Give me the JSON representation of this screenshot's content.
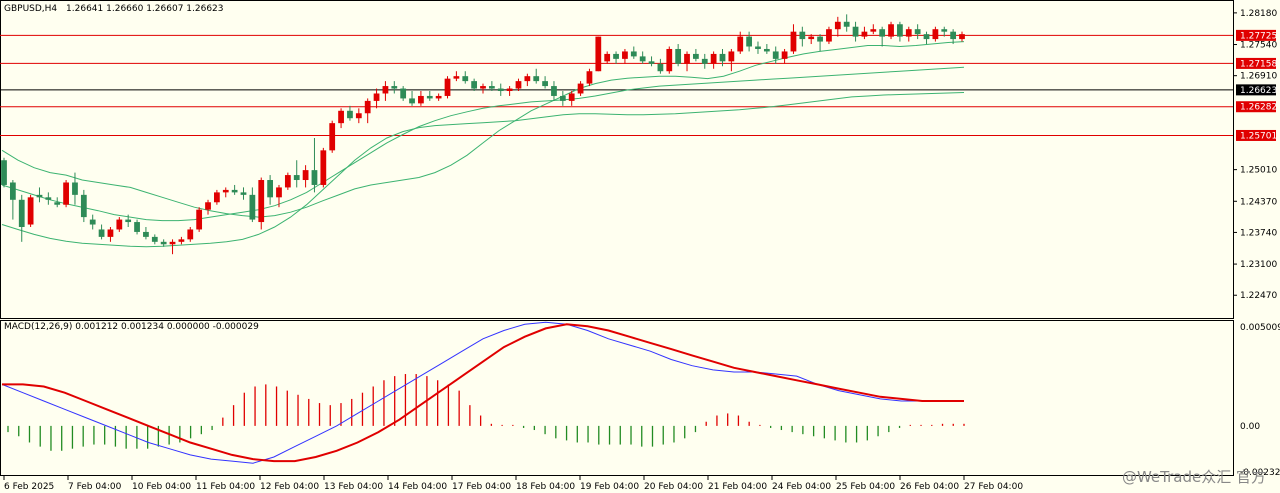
{
  "header": {
    "symbol": "GBPUSD,H4",
    "ohlc": "1.26641 1.26660 1.26607 1.26623"
  },
  "macd_label": "MACD(12,26,9) 0.001212 0.001234 0.000000 -0.000029",
  "watermark": "@WeTrade众汇 官方",
  "chart_data": [
    {
      "type": "candlestick",
      "title": "GBPUSD,H4",
      "ylim": [
        1.2205,
        1.284
      ],
      "y_ticks": [
        "1.28180",
        "1.27540",
        "1.26910",
        "1.25010",
        "1.24370",
        "1.23740",
        "1.23100",
        "1.22470"
      ],
      "x_ticks": [
        "6 Feb 2025",
        "7 Feb 04:00",
        "10 Feb 04:00",
        "11 Feb 04:00",
        "12 Feb 04:00",
        "13 Feb 04:00",
        "14 Feb 04:00",
        "17 Feb 04:00",
        "18 Feb 04:00",
        "19 Feb 04:00",
        "20 Feb 04:00",
        "21 Feb 04:00",
        "24 Feb 04:00",
        "25 Feb 04:00",
        "26 Feb 04:00",
        "27 Feb 04:00"
      ],
      "horizontal_levels": [
        {
          "value": 1.27725,
          "label": "1.27725"
        },
        {
          "value": 1.27158,
          "label": "1.27158"
        },
        {
          "value": 1.26282,
          "label": "1.26282"
        },
        {
          "value": 1.25701,
          "label": "1.25701"
        }
      ],
      "current_price": {
        "value": 1.26623,
        "label": "1.26623"
      },
      "candles": [
        [
          1.252,
          1.2525,
          1.2465,
          1.247
        ],
        [
          1.2475,
          1.248,
          1.24,
          1.244
        ],
        [
          1.244,
          1.245,
          1.2355,
          1.2385
        ],
        [
          1.239,
          1.245,
          1.2385,
          1.2445
        ],
        [
          1.245,
          1.2465,
          1.2435,
          1.2445
        ],
        [
          1.2445,
          1.2455,
          1.243,
          1.244
        ],
        [
          1.2435,
          1.2445,
          1.2425,
          1.243
        ],
        [
          1.243,
          1.248,
          1.2425,
          1.2475
        ],
        [
          1.2475,
          1.2495,
          1.243,
          1.245
        ],
        [
          1.245,
          1.246,
          1.2395,
          1.2405
        ],
        [
          1.24,
          1.241,
          1.238,
          1.239
        ],
        [
          1.238,
          1.239,
          1.236,
          1.2365
        ],
        [
          1.2365,
          1.2385,
          1.2355,
          1.238
        ],
        [
          1.238,
          1.2405,
          1.2375,
          1.24
        ],
        [
          1.24,
          1.241,
          1.2385,
          1.2395
        ],
        [
          1.2395,
          1.24,
          1.237,
          1.2375
        ],
        [
          1.2375,
          1.2385,
          1.236,
          1.2365
        ],
        [
          1.2365,
          1.237,
          1.235,
          1.2355
        ],
        [
          1.2355,
          1.236,
          1.2345,
          1.235
        ],
        [
          1.235,
          1.236,
          1.233,
          1.2355
        ],
        [
          1.2355,
          1.2365,
          1.235,
          1.236
        ],
        [
          1.236,
          1.2385,
          1.2355,
          1.238
        ],
        [
          1.238,
          1.2425,
          1.2375,
          1.242
        ],
        [
          1.242,
          1.244,
          1.241,
          1.2435
        ],
        [
          1.2435,
          1.246,
          1.243,
          1.2455
        ],
        [
          1.2455,
          1.2465,
          1.2445,
          1.246
        ],
        [
          1.246,
          1.247,
          1.245,
          1.2455
        ],
        [
          1.2455,
          1.2465,
          1.244,
          1.245
        ],
        [
          1.245,
          1.2465,
          1.2395,
          1.24
        ],
        [
          1.2395,
          1.2485,
          1.238,
          1.248
        ],
        [
          1.248,
          1.249,
          1.243,
          1.2445
        ],
        [
          1.2445,
          1.247,
          1.2425,
          1.2465
        ],
        [
          1.2465,
          1.2495,
          1.246,
          1.249
        ],
        [
          1.249,
          1.252,
          1.2465,
          1.248
        ],
        [
          1.248,
          1.251,
          1.2465,
          1.25
        ],
        [
          1.25,
          1.2565,
          1.2455,
          1.247
        ],
        [
          1.247,
          1.2545,
          1.2465,
          1.254
        ],
        [
          1.254,
          1.26,
          1.2535,
          1.2595
        ],
        [
          1.2595,
          1.2625,
          1.2585,
          1.262
        ],
        [
          1.262,
          1.263,
          1.26,
          1.2605
        ],
        [
          1.2605,
          1.2625,
          1.2595,
          1.2615
        ],
        [
          1.2615,
          1.2645,
          1.2595,
          1.264
        ],
        [
          1.264,
          1.2665,
          1.2625,
          1.2655
        ],
        [
          1.2655,
          1.268,
          1.264,
          1.267
        ],
        [
          1.267,
          1.268,
          1.2655,
          1.2665
        ],
        [
          1.2665,
          1.267,
          1.264,
          1.2645
        ],
        [
          1.2645,
          1.266,
          1.263,
          1.2635
        ],
        [
          1.2635,
          1.266,
          1.263,
          1.265
        ],
        [
          1.265,
          1.266,
          1.264,
          1.2645
        ],
        [
          1.2645,
          1.2655,
          1.264,
          1.265
        ],
        [
          1.265,
          1.269,
          1.2645,
          1.2685
        ],
        [
          1.2685,
          1.27,
          1.268,
          1.269
        ],
        [
          1.269,
          1.27,
          1.2675,
          1.268
        ],
        [
          1.268,
          1.2685,
          1.266,
          1.2665
        ],
        [
          1.2665,
          1.2675,
          1.2655,
          1.267
        ],
        [
          1.267,
          1.268,
          1.266,
          1.2665
        ],
        [
          1.2665,
          1.2675,
          1.265,
          1.266
        ],
        [
          1.266,
          1.267,
          1.265,
          1.2665
        ],
        [
          1.2665,
          1.2685,
          1.266,
          1.268
        ],
        [
          1.268,
          1.2695,
          1.267,
          1.269
        ],
        [
          1.269,
          1.2705,
          1.2675,
          1.268
        ],
        [
          1.268,
          1.269,
          1.2665,
          1.267
        ],
        [
          1.267,
          1.268,
          1.264,
          1.265
        ],
        [
          1.265,
          1.266,
          1.263,
          1.264
        ],
        [
          1.264,
          1.266,
          1.263,
          1.2655
        ],
        [
          1.2655,
          1.268,
          1.265,
          1.2675
        ],
        [
          1.2675,
          1.2705,
          1.267,
          1.27
        ],
        [
          1.27,
          1.272,
          1.271,
          1.277
        ],
        [
          1.272,
          1.274,
          1.2715,
          1.2735
        ],
        [
          1.2735,
          1.274,
          1.2715,
          1.2725
        ],
        [
          1.2725,
          1.2745,
          1.2715,
          1.274
        ],
        [
          1.274,
          1.275,
          1.2725,
          1.273
        ],
        [
          1.273,
          1.274,
          1.2715,
          1.272
        ],
        [
          1.272,
          1.273,
          1.271,
          1.2715
        ],
        [
          1.2715,
          1.2725,
          1.2695,
          1.27
        ],
        [
          1.27,
          1.275,
          1.2695,
          1.2745
        ],
        [
          1.2745,
          1.2755,
          1.271,
          1.2715
        ],
        [
          1.2715,
          1.274,
          1.27,
          1.2735
        ],
        [
          1.2735,
          1.2745,
          1.272,
          1.2725
        ],
        [
          1.2725,
          1.2735,
          1.2705,
          1.2715
        ],
        [
          1.2715,
          1.274,
          1.2705,
          1.2735
        ],
        [
          1.2735,
          1.2745,
          1.271,
          1.272
        ],
        [
          1.272,
          1.2745,
          1.27,
          1.274
        ],
        [
          1.274,
          1.278,
          1.2735,
          1.277
        ],
        [
          1.277,
          1.278,
          1.274,
          1.275
        ],
        [
          1.275,
          1.276,
          1.2735,
          1.2745
        ],
        [
          1.2745,
          1.2755,
          1.2735,
          1.274
        ],
        [
          1.274,
          1.275,
          1.2715,
          1.2725
        ],
        [
          1.2725,
          1.2745,
          1.2715,
          1.274
        ],
        [
          1.274,
          1.2795,
          1.2735,
          1.278
        ],
        [
          1.278,
          1.279,
          1.275,
          1.2765
        ],
        [
          1.2765,
          1.2775,
          1.2755,
          1.277
        ],
        [
          1.277,
          1.2775,
          1.274,
          1.276
        ],
        [
          1.276,
          1.279,
          1.2755,
          1.2785
        ],
        [
          1.2785,
          1.281,
          1.277,
          1.28
        ],
        [
          1.28,
          1.2815,
          1.278,
          1.279
        ],
        [
          1.279,
          1.28,
          1.276,
          1.277
        ],
        [
          1.277,
          1.279,
          1.2765,
          1.278
        ],
        [
          1.278,
          1.2795,
          1.2775,
          1.2785
        ],
        [
          1.2785,
          1.279,
          1.275,
          1.277
        ],
        [
          1.277,
          1.28,
          1.2765,
          1.2795
        ],
        [
          1.2795,
          1.28,
          1.276,
          1.277
        ],
        [
          1.277,
          1.279,
          1.276,
          1.2785
        ],
        [
          1.2785,
          1.2795,
          1.2765,
          1.2775
        ],
        [
          1.2775,
          1.278,
          1.2755,
          1.2765
        ],
        [
          1.2765,
          1.279,
          1.276,
          1.2785
        ],
        [
          1.2785,
          1.279,
          1.277,
          1.278
        ],
        [
          1.278,
          1.2785,
          1.2755,
          1.2765
        ],
        [
          1.2765,
          1.278,
          1.276,
          1.2775
        ]
      ],
      "bollinger_upper": [
        1.254,
        1.252,
        1.2505,
        1.2495,
        1.249,
        1.248,
        1.2475,
        1.247,
        1.2465,
        1.2455,
        1.2445,
        1.2435,
        1.2425,
        1.2418,
        1.2412,
        1.2408,
        1.2405,
        1.2408,
        1.2415,
        1.2425,
        1.2438,
        1.245,
        1.2462,
        1.247,
        1.2475,
        1.248,
        1.2485,
        1.2495,
        1.251,
        1.253,
        1.2555,
        1.258,
        1.26,
        1.262,
        1.2635,
        1.265,
        1.2665,
        1.2675,
        1.2682,
        1.2686,
        1.2688,
        1.269,
        1.269,
        1.2688,
        1.2685,
        1.269,
        1.27,
        1.2712,
        1.272,
        1.2728,
        1.2735,
        1.274,
        1.2744,
        1.2748,
        1.2752,
        1.2752,
        1.275,
        1.2752,
        1.2755,
        1.2758,
        1.276
      ],
      "bollinger_middle": [
        1.247,
        1.246,
        1.245,
        1.244,
        1.2432,
        1.2425,
        1.2418,
        1.241,
        1.2405,
        1.24,
        1.2398,
        1.2398,
        1.24,
        1.2405,
        1.241,
        1.2415,
        1.242,
        1.2428,
        1.244,
        1.2455,
        1.2475,
        1.2495,
        1.2515,
        1.2535,
        1.2555,
        1.2572,
        1.2588,
        1.26,
        1.261,
        1.2618,
        1.2625,
        1.263,
        1.2634,
        1.2638,
        1.264,
        1.2642,
        1.2645,
        1.265,
        1.2656,
        1.2662,
        1.2666,
        1.267,
        1.2672,
        1.2674,
        1.2676,
        1.2678,
        1.268,
        1.2682,
        1.2684,
        1.2686,
        1.2688,
        1.269,
        1.2692,
        1.2694,
        1.2696,
        1.2698,
        1.27,
        1.2702,
        1.2704,
        1.2706,
        1.2708
      ],
      "bollinger_lower": [
        1.239,
        1.238,
        1.237,
        1.2362,
        1.2356,
        1.2352,
        1.235,
        1.2348,
        1.2346,
        1.2345,
        1.2346,
        1.2348,
        1.235,
        1.2352,
        1.2355,
        1.236,
        1.237,
        1.2385,
        1.2405,
        1.243,
        1.246,
        1.249,
        1.252,
        1.2545,
        1.2565,
        1.2578,
        1.2586,
        1.259,
        1.2592,
        1.2594,
        1.2596,
        1.2598,
        1.26,
        1.2604,
        1.2608,
        1.2612,
        1.2614,
        1.2614,
        1.2613,
        1.2612,
        1.2612,
        1.2613,
        1.2614,
        1.2616,
        1.2618,
        1.262,
        1.2622,
        1.2625,
        1.2628,
        1.2632,
        1.2636,
        1.264,
        1.2644,
        1.2648,
        1.265,
        1.2652,
        1.2653,
        1.2654,
        1.2655,
        1.2656,
        1.2657
      ]
    },
    {
      "type": "macd",
      "title": "MACD(12,26,9) 0.001212 0.001234 0.000000 -0.000029",
      "ylim": [
        -0.00232,
        0.005009
      ],
      "y_ticks": [
        "0.005009",
        "0.00",
        "-0.00232"
      ],
      "histogram": [
        -0.0003,
        -0.0005,
        -0.0008,
        -0.001,
        -0.0012,
        -0.0012,
        -0.0011,
        -0.001,
        -0.0009,
        -0.0009,
        -0.001,
        -0.0011,
        -0.0011,
        -0.0011,
        -0.001,
        -0.0009,
        -0.0008,
        -0.0006,
        -0.0004,
        -0.0002,
        0.0004,
        0.001,
        0.0016,
        0.0019,
        0.002,
        0.0019,
        0.0017,
        0.0015,
        0.0013,
        0.0011,
        0.001,
        0.0011,
        0.0013,
        0.0016,
        0.0019,
        0.0022,
        0.0024,
        0.0025,
        0.0025,
        0.0024,
        0.0022,
        0.002,
        0.0017,
        0.001,
        0.0005,
        0.0001,
        0.0,
        0.0,
        -0.0001,
        -0.0002,
        -0.0004,
        -0.0006,
        -0.0007,
        -0.0008,
        -0.0008,
        -0.0009,
        -0.0009,
        -0.0009,
        -0.0009,
        -0.001,
        -0.001,
        -0.0009,
        -0.0008,
        -0.0006,
        -0.0003,
        0.0002,
        0.0005,
        0.0006,
        0.0005,
        0.0002,
        0.0,
        -0.0001,
        -0.0002,
        -0.0003,
        -0.0004,
        -0.0005,
        -0.0006,
        -0.0007,
        -0.0008,
        -0.0008,
        -0.0007,
        -0.0005,
        -0.0003,
        -0.0001,
        0.0,
        0.0,
        0.0,
        0.0001,
        0.0001,
        0.0001
      ],
      "macd_line": [
        0.002,
        0.0016,
        0.0012,
        0.0008,
        0.0004,
        0.0,
        -0.0004,
        -0.0008,
        -0.0011,
        -0.0014,
        -0.0016,
        -0.0017,
        -0.0018,
        -0.0015,
        -0.001,
        -0.0005,
        0.0,
        0.0006,
        0.0012,
        0.0018,
        0.0024,
        0.003,
        0.0036,
        0.0042,
        0.0046,
        0.0049,
        0.005,
        0.0049,
        0.0046,
        0.0042,
        0.0039,
        0.0036,
        0.0032,
        0.0029,
        0.0027,
        0.0026,
        0.0026,
        0.0025,
        0.0024,
        0.002,
        0.0017,
        0.0015,
        0.0013,
        0.0012,
        0.0012,
        0.0012,
        0.0012
      ],
      "signal_line": [
        0.002,
        0.002,
        0.0019,
        0.0016,
        0.0012,
        0.0008,
        0.0004,
        0.0,
        -0.0004,
        -0.0008,
        -0.0011,
        -0.0014,
        -0.0016,
        -0.0017,
        -0.0017,
        -0.0015,
        -0.0012,
        -0.0008,
        -0.0003,
        0.0003,
        0.001,
        0.0017,
        0.0024,
        0.0031,
        0.0038,
        0.0043,
        0.0047,
        0.0049,
        0.0048,
        0.0046,
        0.0043,
        0.004,
        0.0037,
        0.0034,
        0.0031,
        0.0028,
        0.0026,
        0.0024,
        0.0022,
        0.002,
        0.0018,
        0.0016,
        0.0014,
        0.0013,
        0.0012,
        0.0012,
        0.0012
      ]
    }
  ]
}
